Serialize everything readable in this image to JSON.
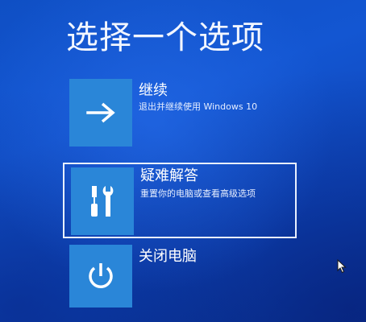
{
  "title": "选择一个选项",
  "options": [
    {
      "label": "继续",
      "description": "退出并继续使用 Windows 10",
      "icon": "arrow-right-icon"
    },
    {
      "label": "疑难解答",
      "description": "重置你的电脑或查看高级选项",
      "icon": "tools-icon"
    },
    {
      "label": "关闭电脑",
      "description": "",
      "icon": "power-icon"
    }
  ],
  "colors": {
    "background": "#1356d2",
    "tile": "#2a86d8",
    "text": "#ffffff"
  }
}
